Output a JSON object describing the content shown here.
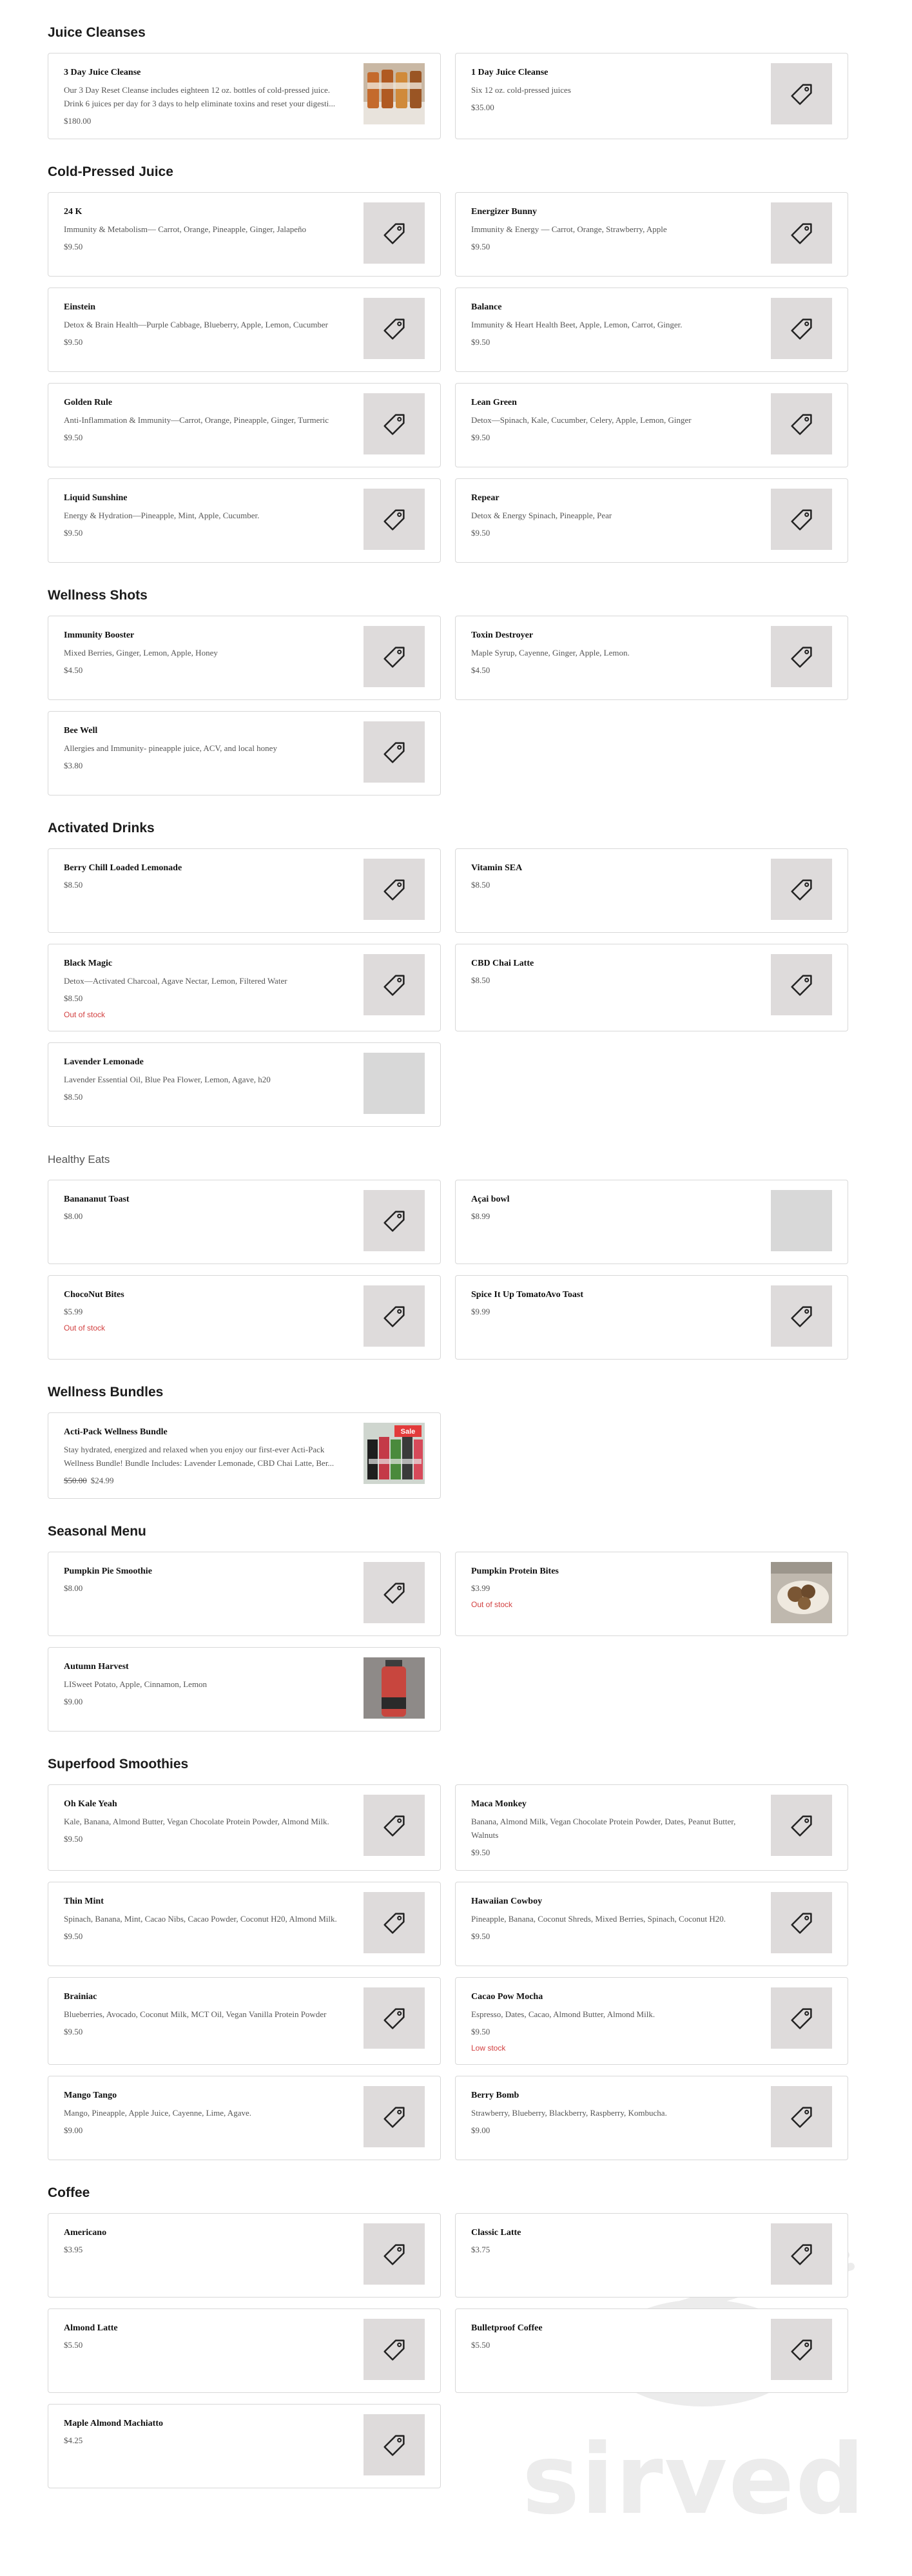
{
  "watermark": {
    "text": "sirved",
    "icon": "fork-plate-icon"
  },
  "colors": {
    "out_of_stock": "#d24040",
    "thumb_bg": "#dedbdb"
  },
  "sections": [
    {
      "title": "Juice Cleanses",
      "items": [
        {
          "name": "3 Day Juice Cleanse",
          "desc": "Our 3 Day Reset Cleanse includes eighteen 12 oz. bottles of cold-pressed juice. Drink 6 juices per day for 3 days to help eliminate toxins and reset your digesti...",
          "price": "$180.00",
          "thumb": "photo-bottles"
        },
        {
          "name": "1 Day Juice Cleanse",
          "desc": "Six 12 oz. cold-pressed juices",
          "price": "$35.00",
          "thumb": "tag-icon"
        }
      ]
    },
    {
      "title": "Cold-Pressed Juice",
      "items": [
        {
          "name": "24 K",
          "desc": "Immunity & Metabolism— Carrot, Orange, Pineapple, Ginger, Jalapeño",
          "price": "$9.50",
          "thumb": "tag-icon"
        },
        {
          "name": "Energizer Bunny",
          "desc": "Immunity & Energy — Carrot, Orange, Strawberry, Apple",
          "price": "$9.50",
          "thumb": "tag-icon"
        },
        {
          "name": "Einstein",
          "desc": "Detox & Brain Health—Purple Cabbage, Blueberry, Apple, Lemon, Cucumber",
          "price": "$9.50",
          "thumb": "tag-icon"
        },
        {
          "name": "Balance",
          "desc": "Immunity & Heart Health Beet, Apple, Lemon, Carrot, Ginger.",
          "price": "$9.50",
          "thumb": "tag-icon"
        },
        {
          "name": "Golden Rule",
          "desc": "Anti-Inflammation & Immunity—Carrot, Orange, Pineapple, Ginger, Turmeric",
          "price": "$9.50",
          "thumb": "tag-icon"
        },
        {
          "name": "Lean Green",
          "desc": "Detox—Spinach, Kale, Cucumber, Celery, Apple, Lemon, Ginger",
          "price": "$9.50",
          "thumb": "tag-icon"
        },
        {
          "name": "Liquid Sunshine",
          "desc": "Energy & Hydration—Pineapple, Mint, Apple, Cucumber.",
          "price": "$9.50",
          "thumb": "tag-icon"
        },
        {
          "name": "Repear",
          "desc": "Detox & Energy Spinach, Pineapple, Pear",
          "price": "$9.50",
          "thumb": "tag-icon"
        }
      ]
    },
    {
      "title": "Wellness Shots",
      "items": [
        {
          "name": "Immunity Booster",
          "desc": "Mixed Berries, Ginger, Lemon, Apple, Honey",
          "price": "$4.50",
          "thumb": "tag-icon"
        },
        {
          "name": "Toxin Destroyer",
          "desc": "Maple Syrup, Cayenne, Ginger, Apple, Lemon.",
          "price": "$4.50",
          "thumb": "tag-icon"
        },
        {
          "name": "Bee Well",
          "desc": "Allergies and Immunity- pineapple juice, ACV, and local honey",
          "price": "$3.80",
          "thumb": "tag-icon"
        }
      ]
    },
    {
      "title": "Activated Drinks",
      "items": [
        {
          "name": "Berry Chill Loaded Lemonade",
          "price": "$8.50",
          "thumb": "tag-icon"
        },
        {
          "name": "Vitamin SEA",
          "price": "$8.50",
          "thumb": "tag-icon"
        },
        {
          "name": "Black Magic",
          "desc": "Detox—Activated Charcoal, Agave Nectar, Lemon, Filtered Water",
          "price": "$8.50",
          "stock": "Out of stock",
          "thumb": "tag-icon"
        },
        {
          "name": "CBD Chai Latte",
          "price": "$8.50",
          "thumb": "tag-icon"
        },
        {
          "name": "Lavender Lemonade",
          "desc": "Lavender Essential Oil, Blue Pea Flower, Lemon, Agave, h20",
          "price": "$8.50",
          "thumb": "blank"
        }
      ]
    },
    {
      "title": "Healthy Eats",
      "light": true,
      "items": [
        {
          "name": "Banananut Toast",
          "price": "$8.00",
          "thumb": "tag-icon"
        },
        {
          "name": "Açai bowl",
          "price": "$8.99",
          "thumb": "blank"
        },
        {
          "name": "ChocoNut Bites",
          "price": "$5.99",
          "stock": "Out of stock",
          "thumb": "tag-icon"
        },
        {
          "name": "Spice It Up TomatoAvo Toast",
          "price": "$9.99",
          "thumb": "tag-icon"
        }
      ]
    },
    {
      "title": "Wellness Bundles",
      "items": [
        {
          "name": "Acti-Pack Wellness Bundle",
          "desc": "Stay hydrated, energized and relaxed when you enjoy our first-ever Acti-Pack Wellness Bundle! Bundle Includes: Lavender Lemonade, CBD Chai Latte, Ber...",
          "old_price": "$50.00",
          "price": "$24.99",
          "thumb": "photo-sale",
          "badge": "Sale"
        }
      ]
    },
    {
      "title": "Seasonal Menu",
      "items": [
        {
          "name": "Pumpkin Pie Smoothie",
          "price": "$8.00",
          "thumb": "tag-icon"
        },
        {
          "name": "Pumpkin Protein Bites",
          "price": "$3.99",
          "stock": "Out of stock",
          "thumb": "photo-bites"
        },
        {
          "name": "Autumn Harvest",
          "desc": "LISweet Potato, Apple, Cinnamon, Lemon",
          "price": "$9.00",
          "thumb": "photo-bottle-red"
        }
      ]
    },
    {
      "title": "Superfood Smoothies",
      "items": [
        {
          "name": "Oh Kale Yeah",
          "desc": "Kale, Banana, Almond Butter, Vegan Chocolate Protein Powder, Almond Milk.",
          "price": "$9.50",
          "thumb": "tag-icon"
        },
        {
          "name": "Maca Monkey",
          "desc": "Banana, Almond Milk, Vegan Chocolate Protein Powder, Dates, Peanut Butter, Walnuts",
          "price": "$9.50",
          "thumb": "tag-icon"
        },
        {
          "name": "Thin Mint",
          "desc": "Spinach, Banana, Mint, Cacao Nibs, Cacao Powder, Coconut H20, Almond Milk.",
          "price": "$9.50",
          "thumb": "tag-icon"
        },
        {
          "name": "Hawaiian Cowboy",
          "desc": "Pineapple, Banana, Coconut Shreds, Mixed Berries, Spinach, Coconut H20.",
          "price": "$9.50",
          "thumb": "tag-icon"
        },
        {
          "name": "Brainiac",
          "desc": "Blueberries, Avocado, Coconut Milk, MCT Oil, Vegan Vanilla Protein Powder",
          "price": "$9.50",
          "thumb": "tag-icon"
        },
        {
          "name": "Cacao Pow Mocha",
          "desc": "Espresso, Dates, Cacao, Almond Butter, Almond Milk.",
          "price": "$9.50",
          "stock": "Low stock",
          "thumb": "tag-icon"
        },
        {
          "name": "Mango Tango",
          "desc": "Mango, Pineapple, Apple Juice, Cayenne, Lime, Agave.",
          "price": "$9.00",
          "thumb": "tag-icon"
        },
        {
          "name": "Berry Bomb",
          "desc": "Strawberry, Blueberry, Blackberry, Raspberry, Kombucha.",
          "price": "$9.00",
          "thumb": "tag-icon"
        }
      ]
    },
    {
      "title": "Coffee",
      "items": [
        {
          "name": "Americano",
          "price": "$3.95",
          "thumb": "tag-icon"
        },
        {
          "name": "Classic Latte",
          "price": "$3.75",
          "thumb": "tag-icon"
        },
        {
          "name": "Almond Latte",
          "price": "$5.50",
          "thumb": "tag-icon"
        },
        {
          "name": "Bulletproof Coffee",
          "price": "$5.50",
          "thumb": "tag-icon"
        },
        {
          "name": "Maple Almond Machiatto",
          "price": "$4.25",
          "thumb": "tag-icon"
        }
      ]
    }
  ]
}
